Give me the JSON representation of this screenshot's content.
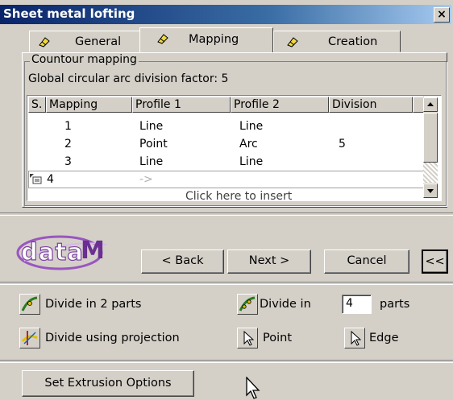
{
  "window": {
    "title": "Sheet metal lofting",
    "close_label": "×"
  },
  "tabs": [
    {
      "label": "General"
    },
    {
      "label": "Mapping"
    },
    {
      "label": "Creation"
    }
  ],
  "group": {
    "title": "Countour mapping",
    "global_factor_text": "Global circular arc division factor: 5"
  },
  "table": {
    "columns": [
      "S.",
      "Mapping",
      "Profile 1",
      "Profile 2",
      "Division"
    ],
    "rows": [
      {
        "mapping": "1",
        "profile1": "Line",
        "profile2": "Line",
        "division": ""
      },
      {
        "mapping": "2",
        "profile1": "Point",
        "profile2": "Arc",
        "division": "5"
      },
      {
        "mapping": "3",
        "profile1": "Line",
        "profile2": "Line",
        "division": ""
      }
    ],
    "new_row": {
      "mapping": "4",
      "profile1": "->"
    },
    "insert_hint": "Click here to insert"
  },
  "logo": {
    "text_data": "data",
    "text_m": "M"
  },
  "nav": {
    "back": "< Back",
    "next": "Next >",
    "cancel": "Cancel",
    "collapse": "<<"
  },
  "tools": {
    "divide2": "Divide in 2 parts",
    "divide_in": "Divide in",
    "parts_value": "4",
    "parts": "parts",
    "divide_projection": "Divide using projection",
    "point": "Point",
    "edge": "Edge"
  },
  "extrusion_button": "Set Extrusion Options",
  "colors": {
    "title_start": "#0a246a",
    "title_end": "#a6caf0",
    "face": "#d4d0c8",
    "logo": "#7a3fa0"
  }
}
